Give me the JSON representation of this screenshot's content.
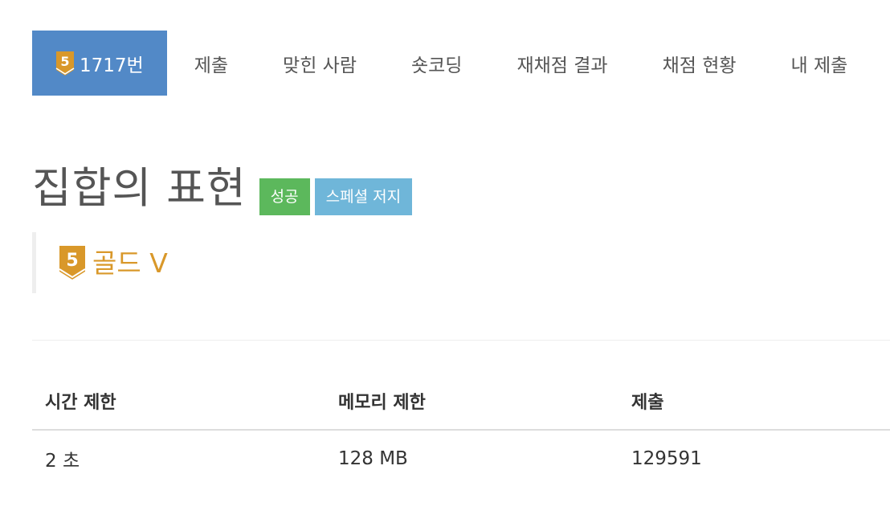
{
  "tabs": [
    {
      "label": "1717번",
      "active": true,
      "tier": "5"
    },
    {
      "label": "제출"
    },
    {
      "label": "맞힌 사람"
    },
    {
      "label": "숏코딩"
    },
    {
      "label": "재채점 결과"
    },
    {
      "label": "채점 현황"
    },
    {
      "label": "내 제출"
    }
  ],
  "problem": {
    "title": "집합의 표현",
    "badges": {
      "status": "성공",
      "judge": "스페셜 저지"
    },
    "tier": {
      "number": "5",
      "name": "골드 V"
    }
  },
  "info_table": {
    "headers": [
      "시간 제한",
      "메모리 제한",
      "제출"
    ],
    "row": [
      "2 초",
      "128 MB",
      "129591"
    ]
  },
  "colors": {
    "tab_active": "#5289c7",
    "badge_success": "#5cb85c",
    "badge_info": "#6fb6d9",
    "gold_tier": "#d9982a"
  },
  "icons": {
    "tier": "gold-tier-badge-icon"
  }
}
